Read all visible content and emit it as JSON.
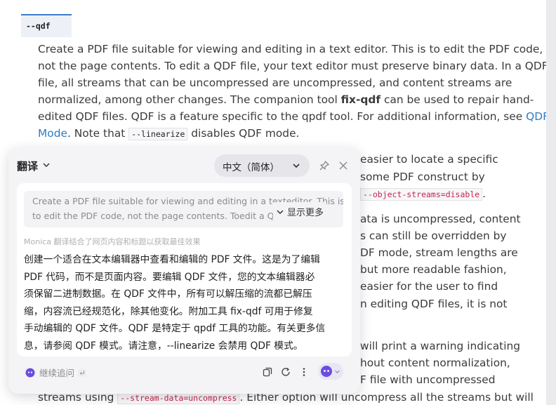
{
  "doc": {
    "option_tag": "--qdf",
    "para1": {
      "l1": "Create a PDF file suitable for viewing and editing in a text editor. This is to edit the PDF code,",
      "l2": "not the page contents. To edit a QDF file, your text editor must preserve binary data. In a QDF",
      "l3": "file, all streams that can be uncompressed are uncompressed, and content streams are",
      "l4_a": "normalized, among other changes. The companion tool ",
      "l4_bold": "fix-qdf",
      "l4_b": " can be used to repair hand-",
      "l5_a": "edited QDF files. QDF is a feature specific to the qpdf tool. For additional information, see ",
      "l5_link": "QDF",
      "l6_link": "Mode",
      "l6_a": ". Note that ",
      "l6_code": "--linearize",
      "l6_b": " disables QDF mode."
    },
    "bg_lines": {
      "p2l1": "easier to locate a specific",
      "p2l2": "some PDF construct by",
      "p2l3_code": "--object-streams=disable",
      "p2l3_end": ".",
      "p3l1": "ata is uncompressed, content",
      "p3l2": "s can still be overridden by",
      "p3l3": "DF mode, stream lengths are",
      "p3l4": "but more readable fashion,",
      "p3l5": "easier for the user to find",
      "p3l6": "n editing QDF files, it is not",
      "p4l1": "will print a warning indicating",
      "p4l2": "hout content normalization,",
      "p4l3": "F file with uncompressed",
      "p4l4_a": "streams using ",
      "p4l4_code": "--stream-data=uncompress",
      "p4l4_b": ". Either option will uncompress all the streams but will"
    }
  },
  "panel": {
    "title": "翻译",
    "language": "中文（简体）",
    "source_line1": "Create a PDF file suitable for viewing and editing in a texteditor. This is",
    "source_line2": "to edit the PDF code, not the page contents. Toedit a QDF",
    "show_more": "显示更多",
    "notice": "Monica 翻译结合了网页内容和标题以获取最佳效果",
    "result_lines": [
      "创建一个适合在文本编辑器中查看和编辑的 PDF 文件。这是为了编辑",
      "PDF 代码，而不是页面内容。要编辑 QDF 文件，您的文本编辑器必",
      "须保留二进制数据。在 QDF 文件中，所有可以解压缩的流都已解压",
      "缩，内容流已经规范化，除其他变化。附加工具 fix-qdf 可用于修复",
      "手动编辑的 QDF 文件。QDF 是特定于 qpdf 工具的功能。有关更多信",
      "息，请参阅 QDF 模式。请注意，--linearize 会禁用 QDF 模式。"
    ],
    "follow_up": "继续追问"
  },
  "colors": {
    "link": "#2e7cc3",
    "code_red": "#c7254e",
    "accent_purple": "#6c4ce0",
    "tag_border": "#3d7cc8"
  },
  "icons": [
    "chevron-down-icon",
    "pin-icon",
    "close-icon",
    "copy-icon",
    "refresh-icon",
    "more-vertical-icon",
    "monica-icon",
    "enter-key-icon"
  ]
}
